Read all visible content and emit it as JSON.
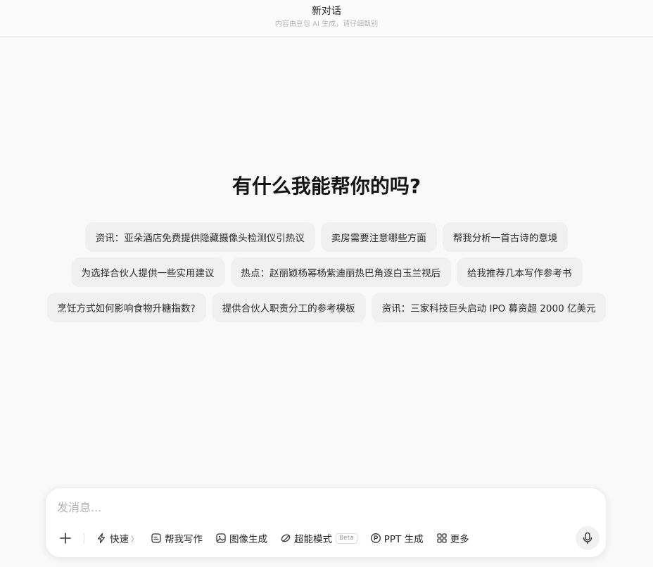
{
  "header": {
    "title": "新对话",
    "subtitle": "内容由豆包 AI 生成，请仔细甄别"
  },
  "main": {
    "greeting": "有什么我能帮你的吗?",
    "suggestions": [
      "资讯：亚朵酒店免费提供隐藏摄像头检测仪引热议",
      "卖房需要注意哪些方面",
      "帮我分析一首古诗的意境",
      "为选择合伙人提供一些实用建议",
      "热点：赵丽颖杨幂杨紫迪丽热巴角逐白玉兰视后",
      "给我推荐几本写作参考书",
      "烹饪方式如何影响食物升糖指数?",
      "提供合伙人职责分工的参考模板",
      "资讯：三家科技巨头启动 IPO 募资超 2000 亿美元"
    ]
  },
  "composer": {
    "placeholder": "发消息...",
    "tools": {
      "quick": "快速",
      "quick_chevron": "〉",
      "writing": "帮我写作",
      "image": "图像生成",
      "super": "超能模式",
      "super_badge": "Beta",
      "ppt": "PPT 生成",
      "more": "更多"
    }
  },
  "icons": {
    "plus": "plus-icon",
    "quick": "lightning-icon",
    "writing": "document-icon",
    "image": "image-icon",
    "super": "sparkle-ring-icon",
    "ppt": "ppt-icon",
    "more": "grid-icon",
    "mic": "microphone-icon"
  }
}
